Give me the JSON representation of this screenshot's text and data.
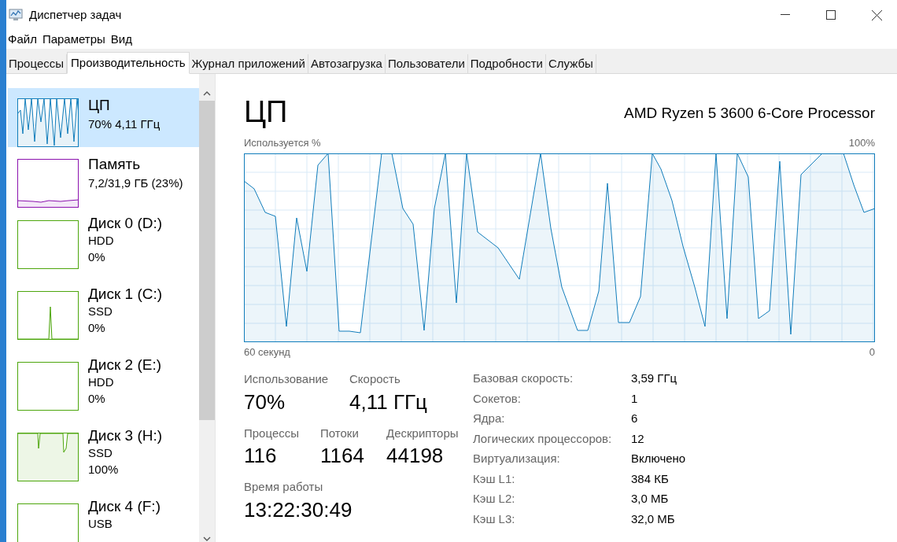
{
  "window": {
    "title": "Диспетчер задач"
  },
  "menu": [
    "Файл",
    "Параметры",
    "Вид"
  ],
  "tabs": [
    {
      "label": "Процессы",
      "selected": false
    },
    {
      "label": "Производительность",
      "selected": true
    },
    {
      "label": "Журнал приложений",
      "selected": false
    },
    {
      "label": "Автозагрузка",
      "selected": false
    },
    {
      "label": "Пользователи",
      "selected": false
    },
    {
      "label": "Подробности",
      "selected": false
    },
    {
      "label": "Службы",
      "selected": false
    }
  ],
  "sidebar": {
    "items": [
      {
        "kind": "cpu",
        "name": "ЦП",
        "detail": "70%  4,11 ГГц",
        "color": "#117dbb",
        "selected": true
      },
      {
        "kind": "memory",
        "name": "Память",
        "detail": "7,2/31,9 ГБ (23%)",
        "color": "#8b12ae",
        "selected": false
      },
      {
        "kind": "disk",
        "name": "Диск 0 (D:)",
        "type": "HDD",
        "detail": "0%",
        "color": "#4da60c",
        "selected": false
      },
      {
        "kind": "disk",
        "name": "Диск 1 (C:)",
        "type": "SSD",
        "detail": "0%",
        "color": "#4da60c",
        "selected": false
      },
      {
        "kind": "disk",
        "name": "Диск 2 (E:)",
        "type": "HDD",
        "detail": "0%",
        "color": "#4da60c",
        "selected": false
      },
      {
        "kind": "disk",
        "name": "Диск 3 (H:)",
        "type": "SSD",
        "detail": "100%",
        "color": "#4da60c",
        "selected": false
      },
      {
        "kind": "disk",
        "name": "Диск 4 (F:)",
        "type": "USB",
        "color": "#4da60c",
        "selected": false
      }
    ]
  },
  "main": {
    "title": "ЦП",
    "model": "AMD Ryzen 5 3600 6-Core Processor",
    "graph_label": "Используется %",
    "graph_max": "100%",
    "graph_start": "60 секунд",
    "graph_end": "0",
    "stats": [
      {
        "label": "Использование",
        "value": "70%"
      },
      {
        "label": "Скорость",
        "value": "4,11 ГГц"
      },
      {
        "label": "Процессы",
        "value": "116"
      },
      {
        "label": "Потоки",
        "value": "1164"
      },
      {
        "label": "Дескрипторы",
        "value": "44198"
      },
      {
        "label": "Время работы",
        "value": "13:22:30:49"
      }
    ],
    "specs": [
      {
        "label": "Базовая скорость:",
        "value": "3,59 ГГц"
      },
      {
        "label": "Сокетов:",
        "value": "1"
      },
      {
        "label": "Ядра:",
        "value": "6"
      },
      {
        "label": "Логических процессоров:",
        "value": "12"
      },
      {
        "label": "Виртуализация:",
        "value": "Включено"
      },
      {
        "label": "Кэш L1:",
        "value": "384 КБ"
      },
      {
        "label": "Кэш L2:",
        "value": "3,0 МБ"
      },
      {
        "label": "Кэш L3:",
        "value": "32,0 МБ"
      }
    ]
  }
}
